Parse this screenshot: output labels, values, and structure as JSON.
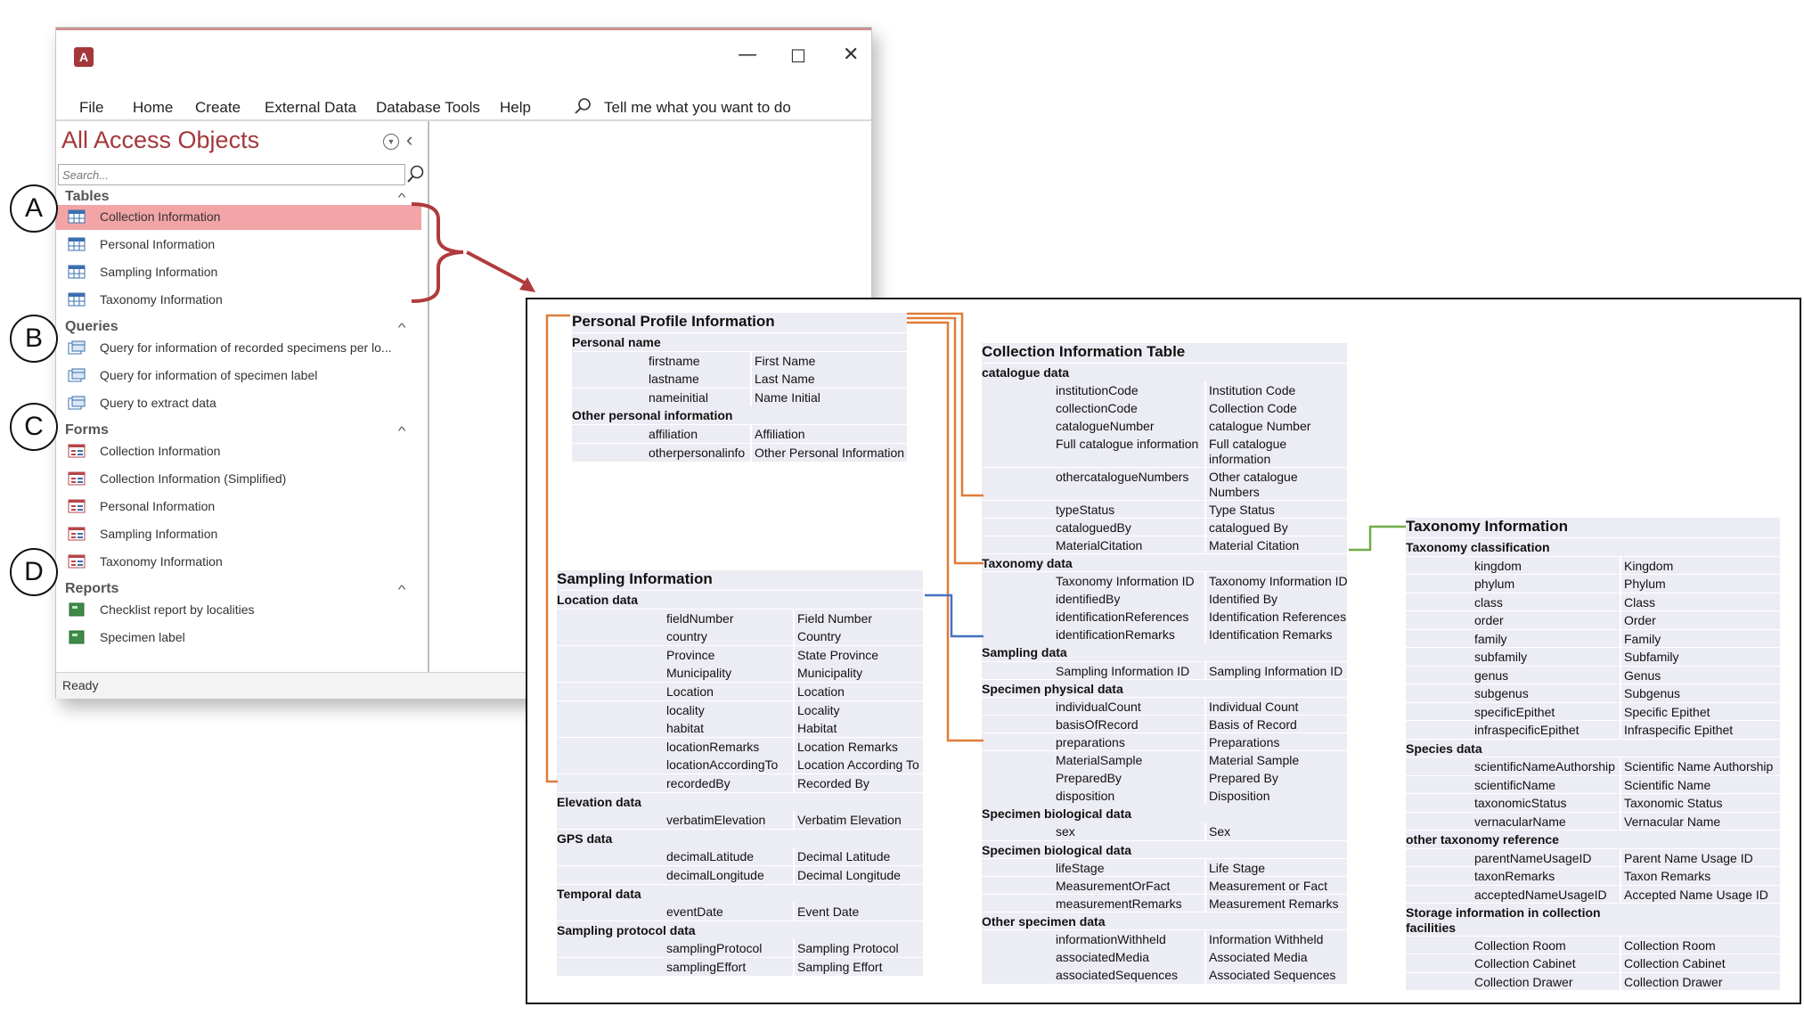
{
  "window": {
    "app_icon": "access-icon",
    "controls": [
      "—",
      "☐",
      "✕"
    ],
    "menu": [
      "File",
      "Home",
      "Create",
      "External Data",
      "Database Tools",
      "Help"
    ],
    "tell_me": "Tell me what you want to do"
  },
  "nav": {
    "title": "All Access Objects",
    "search_placeholder": "Search...",
    "categories": [
      {
        "name": "Tables",
        "items": [
          "Collection Information",
          "Personal Information",
          "Sampling Information",
          "Taxonomy Information"
        ]
      },
      {
        "name": "Queries",
        "items": [
          "Query for information of recorded specimens per lo...",
          "Query for information of specimen label",
          "Query to extract data"
        ]
      },
      {
        "name": "Forms",
        "items": [
          "Collection Information",
          "Collection Information (Simplified)",
          "Personal Information",
          "Sampling Information",
          "Taxonomy Information"
        ]
      },
      {
        "name": "Reports",
        "items": [
          "Checklist report by localities",
          "Specimen label"
        ]
      }
    ],
    "selected": "Collection Information"
  },
  "status": "Ready",
  "callouts": [
    "A",
    "B",
    "C",
    "D"
  ],
  "colors": {
    "accent": "#a4373a",
    "selected": "#f2a4a6",
    "orange": "#e07b39",
    "blue": "#4472c4",
    "green": "#70ad47"
  },
  "tables": {
    "personal": {
      "title": "Personal Profile Information",
      "rows": [
        {
          "section": "Personal name"
        },
        {
          "field": "firstname",
          "label": "First Name"
        },
        {
          "field": "lastname",
          "label": "Last Name"
        },
        {
          "field": "nameinitial",
          "label": "Name Initial"
        },
        {
          "section": "Other personal information"
        },
        {
          "field": "affiliation",
          "label": "Affiliation"
        },
        {
          "field": "otherpersonalinfo",
          "label": "Other Personal Information"
        }
      ]
    },
    "sampling": {
      "title": "Sampling Information",
      "rows": [
        {
          "section": "Location data"
        },
        {
          "field": "fieldNumber",
          "label": "Field Number"
        },
        {
          "field": "country",
          "label": "Country"
        },
        {
          "field": "Province",
          "label": "State Province"
        },
        {
          "field": "Municipality",
          "label": "Municipality"
        },
        {
          "field": "Location",
          "label": "Location"
        },
        {
          "field": "locality",
          "label": "Locality"
        },
        {
          "field": "habitat",
          "label": "Habitat"
        },
        {
          "field": "locationRemarks",
          "label": "Location Remarks"
        },
        {
          "field": "locationAccordingTo",
          "label": "Location According To"
        },
        {
          "field": "recordedBy",
          "label": "Recorded By"
        },
        {
          "section": "Elevation data"
        },
        {
          "field": "verbatimElevation",
          "label": "Verbatim Elevation"
        },
        {
          "section": "GPS data"
        },
        {
          "field": "decimalLatitude",
          "label": "Decimal Latitude"
        },
        {
          "field": "decimalLongitude",
          "label": "Decimal Longitude"
        },
        {
          "section": "Temporal data"
        },
        {
          "field": "eventDate",
          "label": "Event Date"
        },
        {
          "section": "Sampling protocol data"
        },
        {
          "field": "samplingProtocol",
          "label": "Sampling Protocol"
        },
        {
          "field": "samplingEffort",
          "label": "Sampling Effort"
        }
      ]
    },
    "collection": {
      "title": "Collection Information Table",
      "rows": [
        {
          "section": "catalogue data"
        },
        {
          "field": "institutionCode",
          "label": "Institution Code"
        },
        {
          "field": "collectionCode",
          "label": "Collection Code"
        },
        {
          "field": "catalogueNumber",
          "label": "catalogue Number"
        },
        {
          "field": "Full catalogue information",
          "label": "Full catalogue information",
          "tall": true
        },
        {
          "field": "othercatalogueNumbers",
          "label": "Other catalogue Numbers",
          "tall": true
        },
        {
          "field": "typeStatus",
          "label": "Type Status"
        },
        {
          "field": "cataloguedBy",
          "label": "catalogued By"
        },
        {
          "field": "MaterialCitation",
          "label": "Material Citation"
        },
        {
          "section": "Taxonomy data"
        },
        {
          "field": "Taxonomy Information ID",
          "label": "Taxonomy Information ID"
        },
        {
          "field": "identifiedBy",
          "label": "Identified By"
        },
        {
          "field": "identificationReferences",
          "label": "Identification References"
        },
        {
          "field": "identificationRemarks",
          "label": "Identification Remarks"
        },
        {
          "section": "Sampling data"
        },
        {
          "field": "Sampling Information ID",
          "label": "Sampling Information ID"
        },
        {
          "section": "Specimen physical data"
        },
        {
          "field": "individualCount",
          "label": "Individual Count"
        },
        {
          "field": "basisOfRecord",
          "label": "Basis of Record"
        },
        {
          "field": "preparations",
          "label": "Preparations"
        },
        {
          "field": "MaterialSample",
          "label": "Material Sample"
        },
        {
          "field": "PreparedBy",
          "label": "Prepared By"
        },
        {
          "field": "disposition",
          "label": "Disposition"
        },
        {
          "section": "Specimen biological data"
        },
        {
          "field": "sex",
          "label": "Sex"
        },
        {
          "section": "Specimen biological data"
        },
        {
          "field": "lifeStage",
          "label": "Life Stage"
        },
        {
          "field": "MeasurementOrFact",
          "label": "Measurement or Fact"
        },
        {
          "field": "measurementRemarks",
          "label": "Measurement Remarks"
        },
        {
          "section": "Other specimen data"
        },
        {
          "field": "informationWithheld",
          "label": "Information Withheld"
        },
        {
          "field": "associatedMedia",
          "label": "Associated Media"
        },
        {
          "field": "associatedSequences",
          "label": "Associated Sequences"
        }
      ]
    },
    "taxonomy": {
      "title": "Taxonomy Information",
      "rows": [
        {
          "section": "Taxonomy classification"
        },
        {
          "field": "kingdom",
          "label": "Kingdom"
        },
        {
          "field": "phylum",
          "label": "Phylum"
        },
        {
          "field": "class",
          "label": "Class"
        },
        {
          "field": "order",
          "label": "Order"
        },
        {
          "field": "family",
          "label": "Family"
        },
        {
          "field": "subfamily",
          "label": "Subfamily"
        },
        {
          "field": "genus",
          "label": "Genus"
        },
        {
          "field": "subgenus",
          "label": "Subgenus"
        },
        {
          "field": "specificEpithet",
          "label": "Specific Epithet"
        },
        {
          "field": "infraspecificEpithet",
          "label": "Infraspecific Epithet"
        },
        {
          "section": "Species data"
        },
        {
          "field": "scientificNameAuthorship",
          "label": "Scientific Name Authorship"
        },
        {
          "field": "scientificName",
          "label": "Scientific Name"
        },
        {
          "field": "taxonomicStatus",
          "label": "Taxonomic Status"
        },
        {
          "field": "vernacularName",
          "label": "Vernacular Name"
        },
        {
          "section": "other taxonomy reference"
        },
        {
          "field": "parentNameUsageID",
          "label": "Parent Name Usage ID"
        },
        {
          "field": "taxonRemarks",
          "label": "Taxon Remarks"
        },
        {
          "field": "acceptedNameUsageID",
          "label": "Accepted Name Usage ID"
        },
        {
          "section": "Storage information in collection facilities",
          "tall": true
        },
        {
          "field": "Collection Room",
          "label": "Collection Room"
        },
        {
          "field": "Collection Cabinet",
          "label": "Collection Cabinet"
        },
        {
          "field": "Collection Drawer",
          "label": "Collection Drawer"
        }
      ]
    }
  }
}
